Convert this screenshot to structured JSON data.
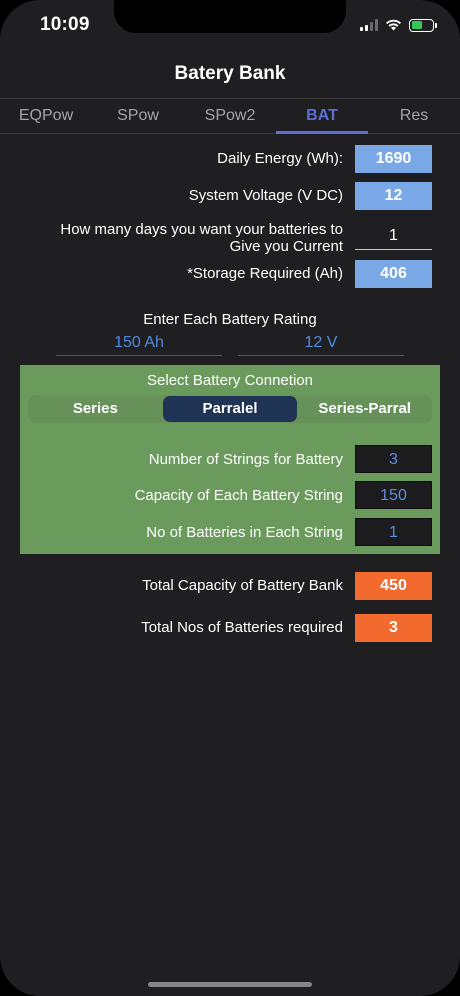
{
  "status_bar": {
    "time": "10:09"
  },
  "title": "Batery Bank",
  "tabs": [
    {
      "label": "EQPow"
    },
    {
      "label": "SPow"
    },
    {
      "label": "SPow2"
    },
    {
      "label": "BAT",
      "active": true
    },
    {
      "label": "Res"
    }
  ],
  "inputs": {
    "daily_energy": {
      "label": "Daily Energy (Wh):",
      "value": "1690"
    },
    "system_voltage": {
      "label": "System Voltage (V DC)",
      "value": "12"
    },
    "days": {
      "label_line1": "How many days you want your batteries to",
      "label_line2": "Give you Current",
      "value": "1"
    },
    "storage_required": {
      "label": "*Storage Required (Ah)",
      "value": "406"
    }
  },
  "battery_rating": {
    "title": "Enter Each Battery Rating",
    "capacity": "150 Ah",
    "voltage": "12 V"
  },
  "connection": {
    "title": "Select Battery Connetion",
    "options": [
      "Series",
      "Parralel",
      "Series-Parral"
    ],
    "selected": "Parralel",
    "strings": {
      "label": "Number of Strings for Battery",
      "value": "3"
    },
    "capacity_per_string": {
      "label": "Capacity of Each Battery String",
      "value": "150"
    },
    "batteries_per_string": {
      "label": "No of Batteries in Each String",
      "value": "1"
    }
  },
  "results": {
    "total_capacity": {
      "label": "Total Capacity of Battery Bank",
      "value": "450"
    },
    "total_batteries": {
      "label": "Total Nos of Batteries required",
      "value": "3"
    }
  },
  "colors": {
    "accent": "#5b6fd6",
    "input_blue": "#7aa8e6",
    "result_orange": "#f26a2e",
    "panel_green": "#6b9b5c"
  }
}
